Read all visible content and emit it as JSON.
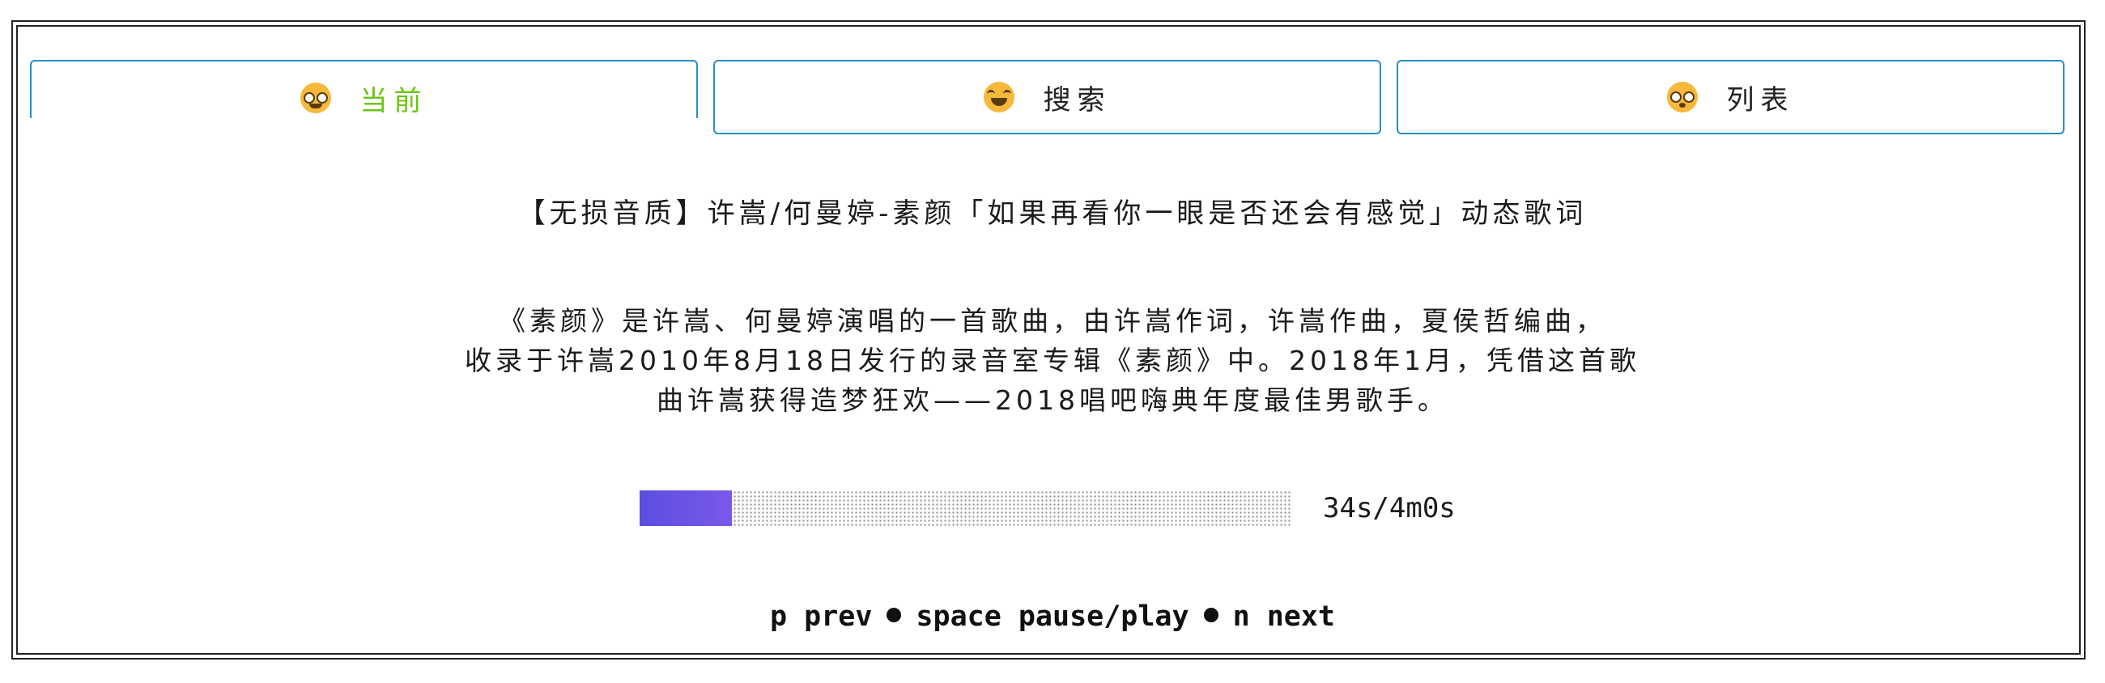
{
  "tabs": [
    {
      "label": "当前",
      "icon": "nerd-face-icon",
      "active": true
    },
    {
      "label": "搜索",
      "icon": "tears-of-joy-face-icon",
      "active": false
    },
    {
      "label": "列表",
      "icon": "flushed-face-icon",
      "active": false
    }
  ],
  "colors": {
    "tab_border": "#2a8fc7",
    "active_tab_text": "#6cc413",
    "progress_fill_start": "#5b4fe0",
    "progress_fill_end": "#7a58e8"
  },
  "song": {
    "title": "【无损音质】许嵩/何曼婷-素颜「如果再看你一眼是否还会有感觉」动态歌词",
    "description_lines": [
      "《素颜》是许嵩、何曼婷演唱的一首歌曲，由许嵩作词，许嵩作曲，夏侯哲编曲，",
      "收录于许嵩2010年8月18日发行的录音室专辑《素颜》中。2018年1月，凭借这首歌",
      "曲许嵩获得造梦狂欢——2018唱吧嗨典年度最佳男歌手。"
    ]
  },
  "player": {
    "elapsed_seconds": 34,
    "total_seconds": 240,
    "time_text": "34s/4m0s"
  },
  "hints": {
    "prev": "p prev",
    "toggle": "space pause/play",
    "next": "n next"
  }
}
